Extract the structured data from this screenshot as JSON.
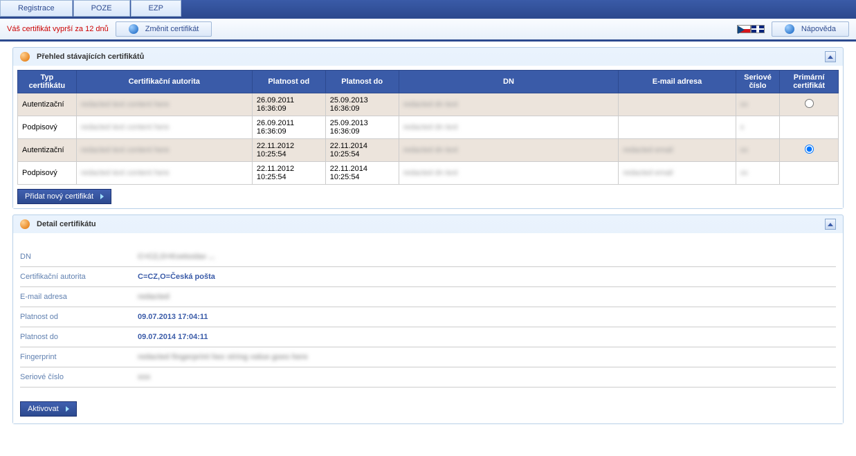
{
  "tabs": {
    "registrace": "Registrace",
    "poze": "POZE",
    "ezp": "EZP"
  },
  "info_bar": {
    "warning": "Váš certifikát vyprší za 12 dnů",
    "change_cert": "Změnit certifikát",
    "help": "Nápověda"
  },
  "panel1": {
    "title": "Přehled stávajících certifikátů"
  },
  "table": {
    "headers": {
      "type": "Typ certifikátu",
      "ca": "Certifikační autorita",
      "valid_from": "Platnost od",
      "valid_to": "Platnost do",
      "dn": "DN",
      "email": "E-mail adresa",
      "serial": "Seriové číslo",
      "primary": "Primární certifikát"
    },
    "rows": [
      {
        "type": "Autentizační",
        "from": "26.09.2011 16:36:09",
        "to": "25.09.2013 16:36:09",
        "primary_checked": false,
        "primary_shown": true
      },
      {
        "type": "Podpisový",
        "from": "26.09.2011 16:36:09",
        "to": "25.09.2013 16:36:09",
        "primary_shown": false
      },
      {
        "type": "Autentizační",
        "from": "22.11.2012 10:25:54",
        "to": "22.11.2014 10:25:54",
        "primary_checked": true,
        "primary_shown": true
      },
      {
        "type": "Podpisový",
        "from": "22.11.2012 10:25:54",
        "to": "22.11.2014 10:25:54",
        "primary_shown": false
      }
    ]
  },
  "buttons": {
    "add_cert": "Přidat nový certifikát",
    "activate": "Aktivovat"
  },
  "panel2": {
    "title": "Detail certifikátu"
  },
  "detail": {
    "labels": {
      "dn": "DN",
      "ca": "Certifikační autorita",
      "email": "E-mail adresa",
      "valid_from": "Platnost od",
      "valid_to": "Platnost do",
      "fingerprint": "Fingerprint",
      "serial": "Seriové číslo"
    },
    "values": {
      "dn": "C=CZ,O=Kvetoslav ...",
      "ca": "C=CZ,O=Česká pošta",
      "email": "",
      "valid_from": "09.07.2013 17:04:11",
      "valid_to": "09.07.2014 17:04:11",
      "fingerprint": "",
      "serial": ""
    }
  }
}
